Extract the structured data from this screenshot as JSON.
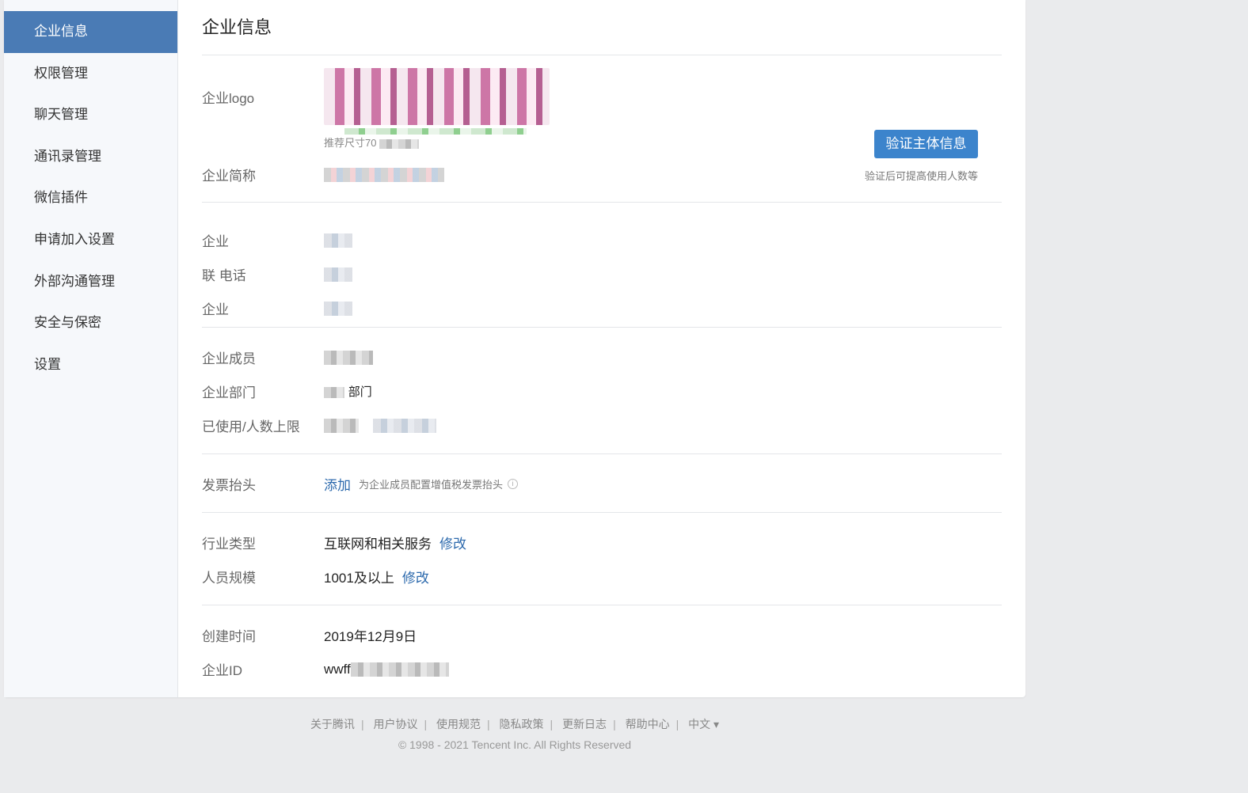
{
  "sidebar": {
    "items": [
      {
        "label": "企业信息",
        "active": true
      },
      {
        "label": "权限管理"
      },
      {
        "label": "聊天管理"
      },
      {
        "label": "通讯录管理"
      },
      {
        "label": "微信插件"
      },
      {
        "label": "申请加入设置"
      },
      {
        "label": "外部沟通管理"
      },
      {
        "label": "安全与保密"
      },
      {
        "label": "设置"
      }
    ]
  },
  "main": {
    "title": "企业信息",
    "logo": {
      "label": "企业logo",
      "hint": "推荐尺寸70"
    },
    "short_name": {
      "label": "企业简称"
    },
    "verify": {
      "button": "验证主体信息",
      "tip": "验证后可提高使用人数等"
    },
    "contact": [
      {
        "label": "企业"
      },
      {
        "label": "联 电话"
      },
      {
        "label": "企业"
      }
    ],
    "members": [
      {
        "label": "企业成员"
      },
      {
        "label": "企业部门",
        "value": "部门"
      },
      {
        "label": "已使用/人数上限"
      }
    ],
    "invoice": {
      "label": "发票抬头",
      "link": "添加",
      "tip": "为企业成员配置增值税发票抬头",
      "icon": "i"
    },
    "industry": {
      "label": "行业类型",
      "value": "互联网和相关服务",
      "edit": "修改"
    },
    "scale": {
      "label": "人员规模",
      "value": "1001及以上",
      "edit": "修改"
    },
    "created": {
      "label": "创建时间",
      "value": "2019年12月9日"
    },
    "corp_id": {
      "label": "企业ID",
      "value": "wwff"
    }
  },
  "footer": {
    "links": [
      "关于腾讯",
      "用户协议",
      "使用规范",
      "隐私政策",
      "更新日志",
      "帮助中心",
      "中文 ▾"
    ],
    "copyright": "© 1998 - 2021 Tencent Inc. All Rights Reserved"
  },
  "colors": {
    "accent": "#4a7bb5",
    "button": "#3c84cc",
    "link": "#2d6aad"
  }
}
